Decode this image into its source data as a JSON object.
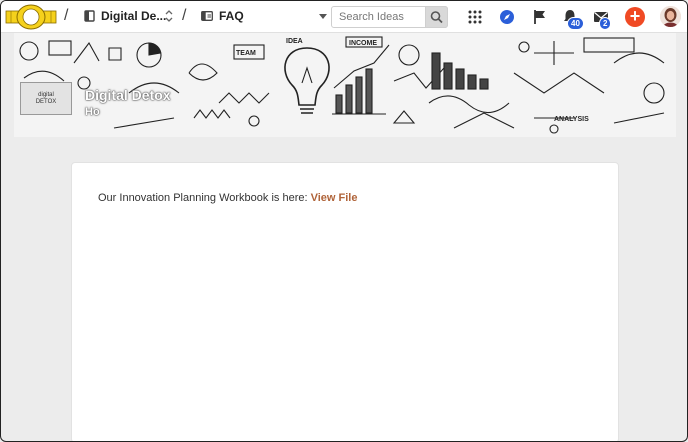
{
  "topbar": {
    "breadcrumb_separator": "/",
    "workspace_label": "Digital De...",
    "section_label": "FAQ",
    "search_placeholder": "Search Ideas",
    "notifications_count": "40",
    "messages_count": "2",
    "add_label": "+",
    "accent_color": "#f04a24",
    "badge_color": "#2b5fd9"
  },
  "banner": {
    "logo_text_line1": "digital",
    "logo_text_line2": "DETOX",
    "title": "Digital Detox",
    "subtitle": "Ho"
  },
  "content": {
    "body_text": "Our Innovation Planning Workbook is here: ",
    "link_text": "View File",
    "link_color": "#b0643a"
  },
  "icons": {
    "logo": "brand-logo-icon",
    "workspace": "workspace-icon",
    "section": "folder-icon",
    "updown": "chevron-updown-icon",
    "search": "search-icon",
    "apps": "grid-icon",
    "explore": "compass-icon",
    "flag": "flag-icon",
    "notifications": "bell-icon",
    "messages": "mail-icon",
    "avatar": "avatar"
  }
}
